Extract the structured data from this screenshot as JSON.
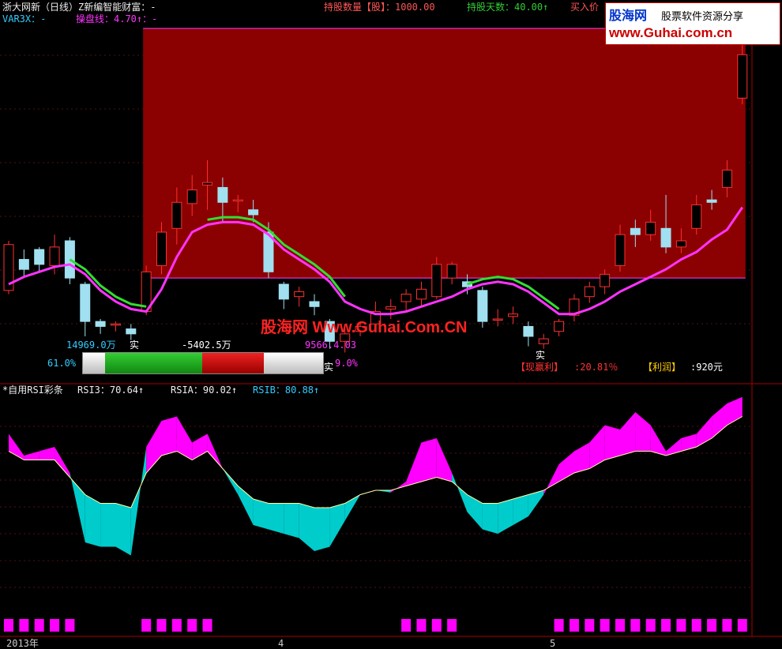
{
  "header": {
    "title": "浙大网新（日线）Z新编智能财富：-",
    "holding_qty": "持股数量【股】：1000.00",
    "holding_days": "持股天数：40.00↑",
    "buy_price": "买入价",
    "var3x": "VAR3X：-",
    "control_line": "操盘线：4.70↑：-"
  },
  "brand": {
    "top_left": "股海网",
    "top_right": "股票软件资源分享",
    "url": "www.Guhai.com.cn"
  },
  "watermark": "股海网 Www.Guhai.Com.CN",
  "info": {
    "val1": "14969.0万",
    "val2": "-5402.5万",
    "val3": "9566.4.03",
    "pct_left": "61.0%",
    "pct_right": "9.0%",
    "glyph_shi": "实",
    "current_profit_label": "【现赢利】",
    "current_profit": ":20.81％",
    "profit_label": "【利润】",
    "profit": ":920元"
  },
  "rsi_header": {
    "name": "*自用RSI彩条",
    "rsi3": "RSI3：70.64↑",
    "rsia": "RSIA：90.02↑",
    "rsib": "RSIB：80.88↑"
  },
  "axis": {
    "x_labels": [
      "2013年",
      "4",
      "5"
    ]
  },
  "colors": {
    "up": "#ff3030",
    "down": "#a0e0f0",
    "buy_zone": "#8b0000",
    "ma": "#ff33ff",
    "trail": "#33dd33",
    "rsi_up": "#ff00ff",
    "rsi_down": "#00cccc",
    "rsi_line": "#ffffa0"
  },
  "chart_data": [
    {
      "type": "candlestick",
      "title": "",
      "ohlc": [
        [
          4.05,
          4.42,
          4.02,
          4.45
        ],
        [
          4.3,
          4.22,
          4.15,
          4.38
        ],
        [
          4.38,
          4.26,
          4.2,
          4.4
        ],
        [
          4.25,
          4.4,
          4.18,
          4.5
        ],
        [
          4.45,
          4.15,
          4.1,
          4.48
        ],
        [
          4.1,
          3.8,
          3.68,
          4.12
        ],
        [
          3.8,
          3.76,
          3.7,
          3.82
        ],
        [
          3.78,
          3.78,
          3.72,
          3.8
        ],
        [
          3.74,
          3.7,
          3.65,
          3.78
        ],
        [
          3.88,
          4.2,
          3.85,
          4.25
        ],
        [
          4.25,
          4.52,
          4.18,
          4.6
        ],
        [
          4.55,
          4.76,
          4.42,
          4.88
        ],
        [
          4.75,
          4.86,
          4.65,
          4.98
        ],
        [
          4.9,
          4.92,
          4.7,
          5.1
        ],
        [
          4.88,
          4.76,
          4.6,
          4.96
        ],
        [
          4.78,
          4.78,
          4.68,
          4.82
        ],
        [
          4.7,
          4.66,
          4.6,
          4.78
        ],
        [
          4.52,
          4.2,
          4.15,
          4.6
        ],
        [
          4.1,
          3.98,
          3.9,
          4.12
        ],
        [
          4.0,
          4.04,
          3.92,
          4.08
        ],
        [
          3.96,
          3.92,
          3.85,
          4.02
        ],
        [
          3.8,
          3.64,
          3.58,
          3.82
        ],
        [
          3.64,
          3.7,
          3.55,
          3.74
        ],
        [
          3.72,
          3.76,
          3.68,
          3.8
        ],
        [
          3.78,
          3.88,
          3.74,
          3.96
        ],
        [
          3.9,
          3.92,
          3.82,
          3.98
        ],
        [
          3.96,
          4.02,
          3.88,
          4.06
        ],
        [
          3.98,
          4.06,
          3.92,
          4.12
        ],
        [
          4.0,
          4.26,
          3.98,
          4.32
        ],
        [
          4.15,
          4.26,
          4.1,
          4.28
        ],
        [
          4.12,
          4.08,
          4.02,
          4.18
        ],
        [
          4.05,
          3.8,
          3.75,
          4.08
        ],
        [
          3.82,
          3.82,
          3.76,
          3.9
        ],
        [
          3.84,
          3.86,
          3.78,
          3.92
        ],
        [
          3.76,
          3.68,
          3.6,
          3.8
        ],
        [
          3.62,
          3.66,
          3.58,
          3.7
        ],
        [
          3.72,
          3.8,
          3.68,
          3.82
        ],
        [
          3.85,
          3.98,
          3.8,
          4.02
        ],
        [
          4.0,
          4.08,
          3.95,
          4.12
        ],
        [
          4.08,
          4.18,
          4.02,
          4.22
        ],
        [
          4.25,
          4.5,
          4.2,
          4.58
        ],
        [
          4.55,
          4.5,
          4.4,
          4.62
        ],
        [
          4.5,
          4.6,
          4.45,
          4.7
        ],
        [
          4.55,
          4.4,
          4.35,
          4.82
        ],
        [
          4.4,
          4.45,
          4.35,
          4.55
        ],
        [
          4.55,
          4.74,
          4.5,
          4.82
        ],
        [
          4.78,
          4.76,
          4.7,
          4.86
        ],
        [
          4.88,
          5.02,
          4.8,
          5.1
        ],
        [
          5.6,
          5.95,
          5.55,
          6.1
        ]
      ],
      "ma": [
        4.1,
        4.16,
        4.2,
        4.24,
        4.26,
        4.18,
        4.05,
        3.96,
        3.9,
        3.88,
        4.06,
        4.32,
        4.52,
        4.58,
        4.6,
        4.6,
        4.58,
        4.5,
        4.38,
        4.3,
        4.22,
        4.12,
        3.96,
        3.9,
        3.86,
        3.86,
        3.88,
        3.92,
        3.96,
        4.0,
        4.06,
        4.1,
        4.12,
        4.1,
        4.04,
        3.95,
        3.86,
        3.86,
        3.9,
        3.96,
        4.04,
        4.1,
        4.16,
        4.22,
        4.3,
        4.36,
        4.46,
        4.54,
        4.72
      ],
      "ylim": [
        3.4,
        6.2
      ]
    },
    {
      "type": "area",
      "title": "",
      "rsi3": [
        82,
        72,
        74,
        76,
        64,
        32,
        30,
        30,
        26,
        76,
        88,
        90,
        78,
        82,
        66,
        54,
        40,
        38,
        36,
        34,
        28,
        30,
        42,
        54,
        56,
        55,
        60,
        78,
        80,
        64,
        46,
        38,
        36,
        40,
        44,
        54,
        68,
        74,
        78,
        86,
        84,
        92,
        86,
        74,
        80,
        82,
        90,
        96,
        99
      ],
      "rsib": [
        74,
        70,
        70,
        70,
        62,
        54,
        50,
        50,
        48,
        64,
        72,
        74,
        70,
        74,
        66,
        58,
        52,
        50,
        50,
        50,
        48,
        48,
        50,
        54,
        56,
        56,
        58,
        60,
        62,
        60,
        54,
        50,
        50,
        52,
        54,
        56,
        60,
        64,
        66,
        70,
        72,
        74,
        74,
        72,
        74,
        76,
        80,
        86,
        90
      ],
      "ylim": [
        20,
        100
      ]
    }
  ]
}
